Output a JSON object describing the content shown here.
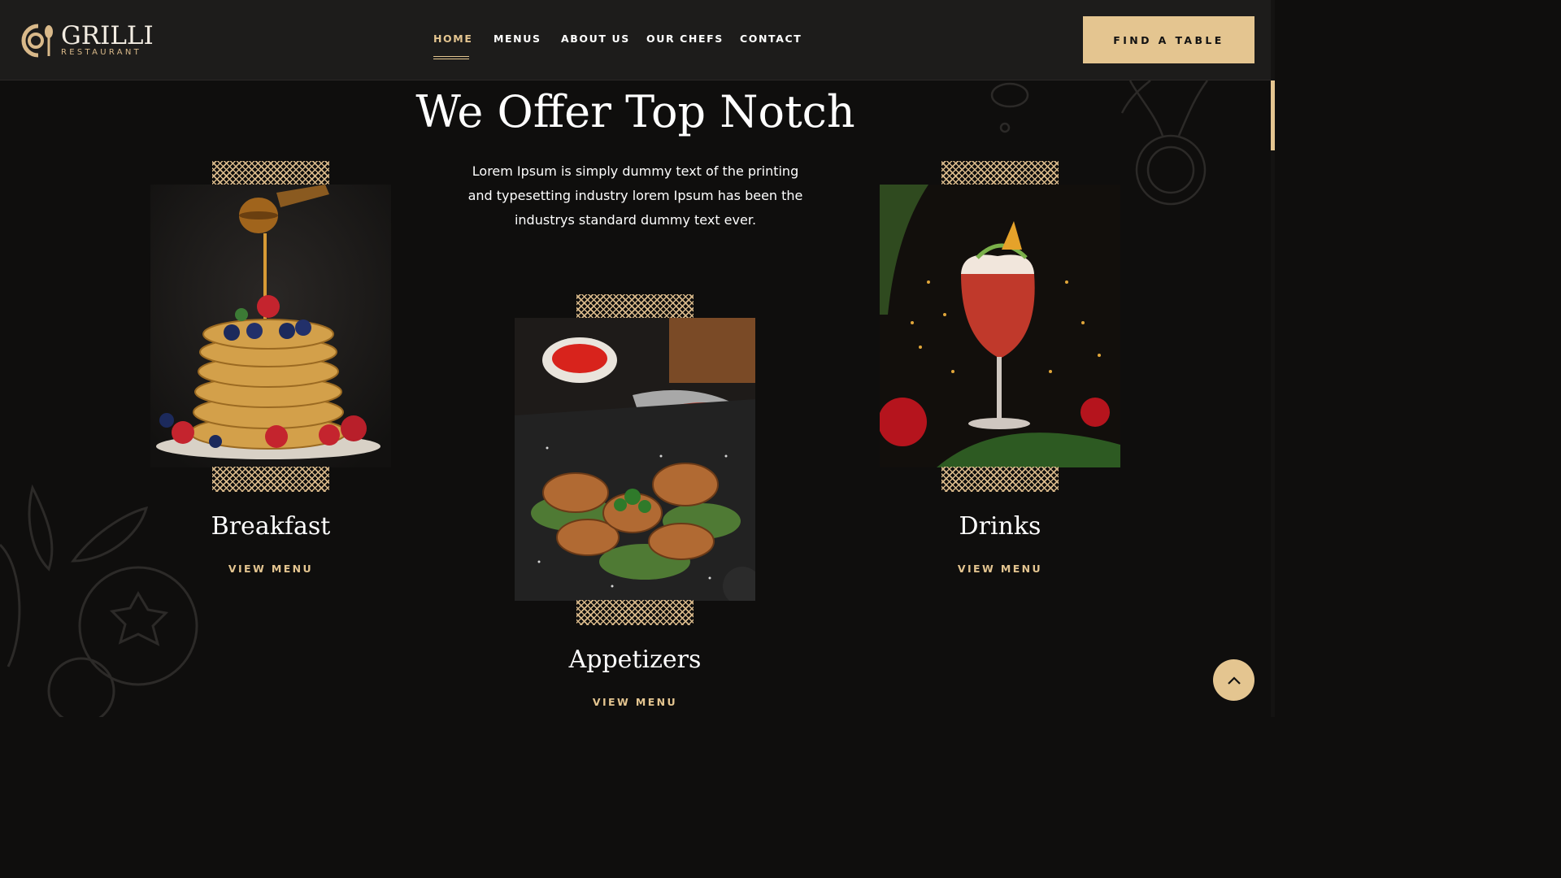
{
  "brand": {
    "name": "GRILLI",
    "tagline": "RESTAURANT"
  },
  "nav": {
    "items": [
      {
        "label": "HOME",
        "active": true
      },
      {
        "label": "MENUS",
        "active": false
      },
      {
        "label": "ABOUT US",
        "active": false
      },
      {
        "label": "OUR CHEFS",
        "active": false
      },
      {
        "label": "CONTACT",
        "active": false
      }
    ]
  },
  "header": {
    "cta_label": "FIND A TABLE"
  },
  "section": {
    "title": "We Offer Top Notch",
    "lead": "Lorem Ipsum is simply dummy text of the printing and typesetting industry lorem Ipsum has been the industrys standard dummy text ever."
  },
  "cards": [
    {
      "name": "Breakfast",
      "link": "VIEW MENU",
      "photo": "pancakes-with-berries-and-honey"
    },
    {
      "name": "Appetizers",
      "link": "VIEW MENU",
      "photo": "grilled-chicken-wings-with-sauces"
    },
    {
      "name": "Drinks",
      "link": "VIEW MENU",
      "photo": "red-cocktail-with-garnish"
    }
  ],
  "icons": {
    "back_to_top": "chevron-up-icon",
    "logo": "fork-plate-logo-icon"
  },
  "colors": {
    "accent": "#e4c590",
    "background": "#0f0e0d",
    "header": "#1d1c1b"
  }
}
